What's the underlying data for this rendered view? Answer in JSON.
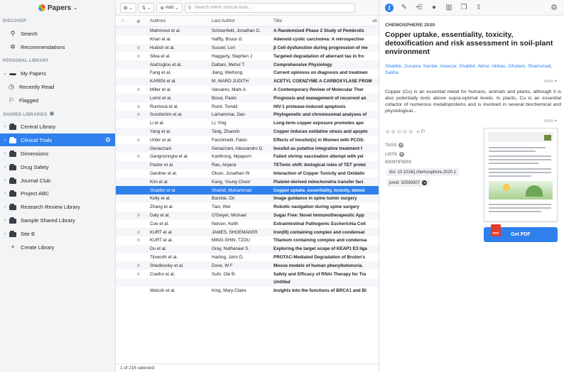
{
  "app": {
    "name": "Papers"
  },
  "sidebar": {
    "discover_header": "DISCOVER",
    "discover": [
      {
        "label": "Search",
        "icon": "search-icon"
      },
      {
        "label": "Recommendations",
        "icon": "recommendations-icon"
      }
    ],
    "personal_header": "PERSONAL LIBRARY",
    "personal": [
      {
        "label": "My Papers",
        "icon": "inbox-icon"
      },
      {
        "label": "Recently Read",
        "icon": "clock-icon"
      },
      {
        "label": "Flagged",
        "icon": "flag-icon"
      }
    ],
    "shared_header": "SHARED LIBRARIES",
    "shared": [
      {
        "label": "Central Library"
      },
      {
        "label": "Clinical Trials",
        "active": true
      },
      {
        "label": "Dimensions"
      },
      {
        "label": "Drug Safety"
      },
      {
        "label": "Journal Club"
      },
      {
        "label": "Project ABC"
      },
      {
        "label": "Research Review Library"
      },
      {
        "label": "Sample Shared Library"
      },
      {
        "label": "Site B"
      }
    ],
    "create_label": "Create Library"
  },
  "toolbar": {
    "add_label": "Add",
    "search_placeholder": "Search within clinical trials..."
  },
  "table": {
    "headers": [
      "",
      "",
      "Authors",
      "Last Author",
      "Title"
    ],
    "title_header_tail": "ati",
    "rows": [
      {
        "clip": false,
        "authors": "Mahmood et al.",
        "last": "Schoenfeld, Jonathan D.",
        "title": "A Randomized Phase 2 Study of Pembroliz"
      },
      {
        "clip": false,
        "authors": "Khan et al.",
        "last": "Haffty, Bruce G.",
        "title": "Adenoid cystic carcinoma: A retrospective"
      },
      {
        "clip": true,
        "authors": "Hudish et al.",
        "last": "Sussel, Lori",
        "title": "β Cell dysfunction during progression of me"
      },
      {
        "clip": true,
        "authors": "Silva et al.",
        "last": "Haggarty, Stephen J",
        "title": "Targeted degradation of aberrant tau in fro"
      },
      {
        "clip": false,
        "authors": "Alatzoglou et al.",
        "last": "Dattani, Mehul T.",
        "title": "Comprehensive Physiology"
      },
      {
        "clip": false,
        "authors": "Fang et al.",
        "last": "Jiang, Weihong",
        "title": "Current opinions on diagnosis and treatmen"
      },
      {
        "clip": false,
        "authors": "KAREN et al.",
        "last": "M, WARD JUDITH",
        "title": "ACETYL COENZYME A CARBOXYLASE FROM"
      },
      {
        "clip": true,
        "authors": "Miller et al.",
        "last": "Varvares, Mark A.",
        "title": "A Contemporary Review of Molecular Ther"
      },
      {
        "clip": false,
        "authors": "Lorini et al.",
        "last": "Bossi, Paolo",
        "title": "Prognosis and management of recurrent an"
      },
      {
        "clip": true,
        "authors": "Rumlová et al.",
        "last": "Ruml, Tomáš",
        "title": "HIV-1 protease-induced apoptosis"
      },
      {
        "clip": true,
        "authors": "Sundström et al.",
        "last": "Larhammar, Dan",
        "title": "Phylogenetic and chromosomal analyses of"
      },
      {
        "clip": false,
        "authors": "Li et al.",
        "last": "Li, Ying",
        "title": "Long-term copper exposure promotes apo"
      },
      {
        "clip": false,
        "authors": "Yang et al.",
        "last": "Tang, Zhaoxin",
        "title": "Copper induces oxidative stress and apopto"
      },
      {
        "clip": true,
        "authors": "Unfer et al.",
        "last": "Facchinetti, Fabio",
        "title": "Effects of Inositol(s) in Women with PCOS:"
      },
      {
        "clip": false,
        "authors": "Genazzani",
        "last": "Genazzani, Alessandro D.",
        "title": "Inositol as putative integrative treatment f"
      },
      {
        "clip": true,
        "authors": "Gangnonngiw et al.",
        "last": "Kanthong, Nipaporn",
        "title": "Failed shrimp vaccination attempt with yel"
      },
      {
        "clip": false,
        "authors": "Pastor et al.",
        "last": "Rao, Anjana",
        "title": "TETonic shift: biological roles of TET protei"
      },
      {
        "clip": false,
        "authors": "Gardner et al.",
        "last": "Olson, Jonathan W",
        "title": "Interaction of Copper Toxicity and Oxidativ"
      },
      {
        "clip": false,
        "authors": "Kim et al.",
        "last": "Kang, Young Cheol",
        "title": "Platelet-derived mitochondria transfer faci"
      },
      {
        "clip": false,
        "selected": true,
        "authors": "Shabbir et al.",
        "last": "Shahid, Muhammad",
        "title": "Copper uptake, essentiality, toxicity, detoxi"
      },
      {
        "clip": false,
        "authors": "Kelly et al.",
        "last": "Barzilai, Ori",
        "title": "Image guidance in spine tumor surgery"
      },
      {
        "clip": false,
        "authors": "Zhang et al.",
        "last": "Tian, Wei",
        "title": "Robotic navigation during spine surgery"
      },
      {
        "clip": true,
        "authors": "Daly et al.",
        "last": "O'Dwyer, Michael",
        "title": "Sugar Free: Novel Immunotherapeutic App"
      },
      {
        "clip": false,
        "authors": "Coe et al.",
        "last": "Nelson, Keith",
        "title": "Extraintestinal Pathogenic Escherichia Coli"
      },
      {
        "clip": true,
        "authors": "KURT et al.",
        "last": "JAMES, SHOEMAKER",
        "title": "Iron(III) containing complex and condensat"
      },
      {
        "clip": true,
        "authors": "KURT et al.",
        "last": "MING-SHIN, TZOU",
        "title": "Titanium containing complex and condensa"
      },
      {
        "clip": false,
        "authors": "Du et al.",
        "last": "Gray, Nathanael S.",
        "title": "Exploring the target scope of KEAP1 E3 liga"
      },
      {
        "clip": false,
        "authors": "Tinworth et al.",
        "last": "Harling, John D.",
        "title": "PROTAC-Mediated Degradation of Bruton's"
      },
      {
        "clip": true,
        "authors": "Shedlovsky et al.",
        "last": "Dove, W F",
        "title": "Mouse models of human phenylketonuria."
      },
      {
        "clip": true,
        "authors": "Coelho et al.",
        "last": "Suhr, Ole B.",
        "title": "Safety and Efficacy of RNAi Therapy for Tra"
      },
      {
        "clip": false,
        "authors": "",
        "last": "",
        "title": "Untitled",
        "italic": true
      },
      {
        "clip": false,
        "authors": "Welcsh et al.",
        "last": "King, Mary-Claire",
        "title": "Insights into the functions of BRCA1 and BI"
      }
    ]
  },
  "status": {
    "selection": "1 of 216 selected"
  },
  "detail": {
    "journal": "CHEMOSPHERE 2020",
    "title": "Copper uptake, essentiality, toxicity, detoxification and risk assessment in soil-plant environment",
    "authors": "Shabbir, Zunaira; Sardar, Aneeza; Shabbir, Abrar; Abbas, Ghulam; Shamshad, Saliha",
    "more1": "more",
    "abstract": "Copper (Cu) is an essential metal for humans, animals and plants, although it is also potentially toxic above supra-optimal levels. In plants, Cu is an essential cofactor of numerous metalloproteins and is involved in several biochemical and physiological...",
    "more2": "more",
    "tags_label": "TAGS",
    "lists_label": "LISTS",
    "identifiers_label": "IDENTIFIERS",
    "doi": "doi: 10.1016/j.chemosphere.2020.1",
    "pmid": "pmid: 32599307",
    "get_pdf": "Get PDF"
  },
  "colors": {
    "accent": "#2f80ed"
  }
}
